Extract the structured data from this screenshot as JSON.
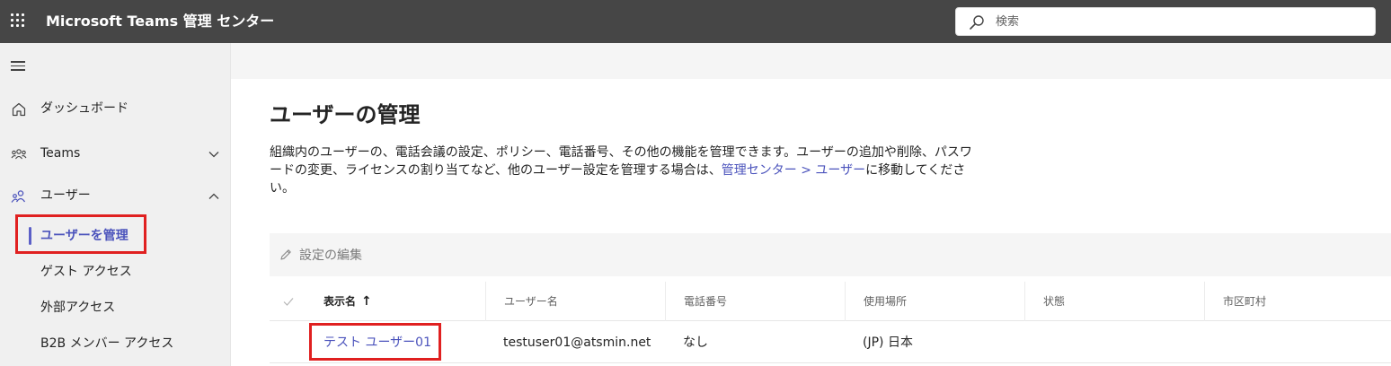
{
  "header": {
    "app_title": "Microsoft Teams 管理 センター",
    "search_placeholder": "検索"
  },
  "sidebar": {
    "items": [
      {
        "label": "ダッシュボード",
        "icon": "home-icon"
      },
      {
        "label": "Teams",
        "icon": "teams-icon",
        "expanded": false
      },
      {
        "label": "ユーザー",
        "icon": "users-icon",
        "expanded": true
      }
    ],
    "sub_items": [
      {
        "label": "ユーザーを管理",
        "active": true
      },
      {
        "label": "ゲスト アクセス"
      },
      {
        "label": "外部アクセス"
      },
      {
        "label": "B2B メンバー アクセス"
      }
    ]
  },
  "main": {
    "title": "ユーザーの管理",
    "description_part1": "組織内のユーザーの、電話会議の設定、ポリシー、電話番号、その他の機能を管理できます。ユーザーの追加や削除、パスワードの変更、ライセンスの割り当てなど、他のユーザー設定を管理する場合は、",
    "description_link": "管理センター > ユーザー",
    "description_part2": "に移動してください。",
    "toolbar_edit_label": "設定の編集",
    "table": {
      "columns": [
        "表示名",
        "ユーザー名",
        "電話番号",
        "使用場所",
        "状態",
        "市区町村"
      ],
      "sort_indicator": "↑",
      "rows": [
        {
          "display_name": "テスト ユーザー01",
          "username": "testuser01@atsmin.net",
          "phone": "なし",
          "location": "(JP) 日本",
          "status": "",
          "city": ""
        }
      ]
    }
  },
  "colors": {
    "topbar": "#464646",
    "accent": "#4b53bc",
    "highlight": "#e02020"
  }
}
